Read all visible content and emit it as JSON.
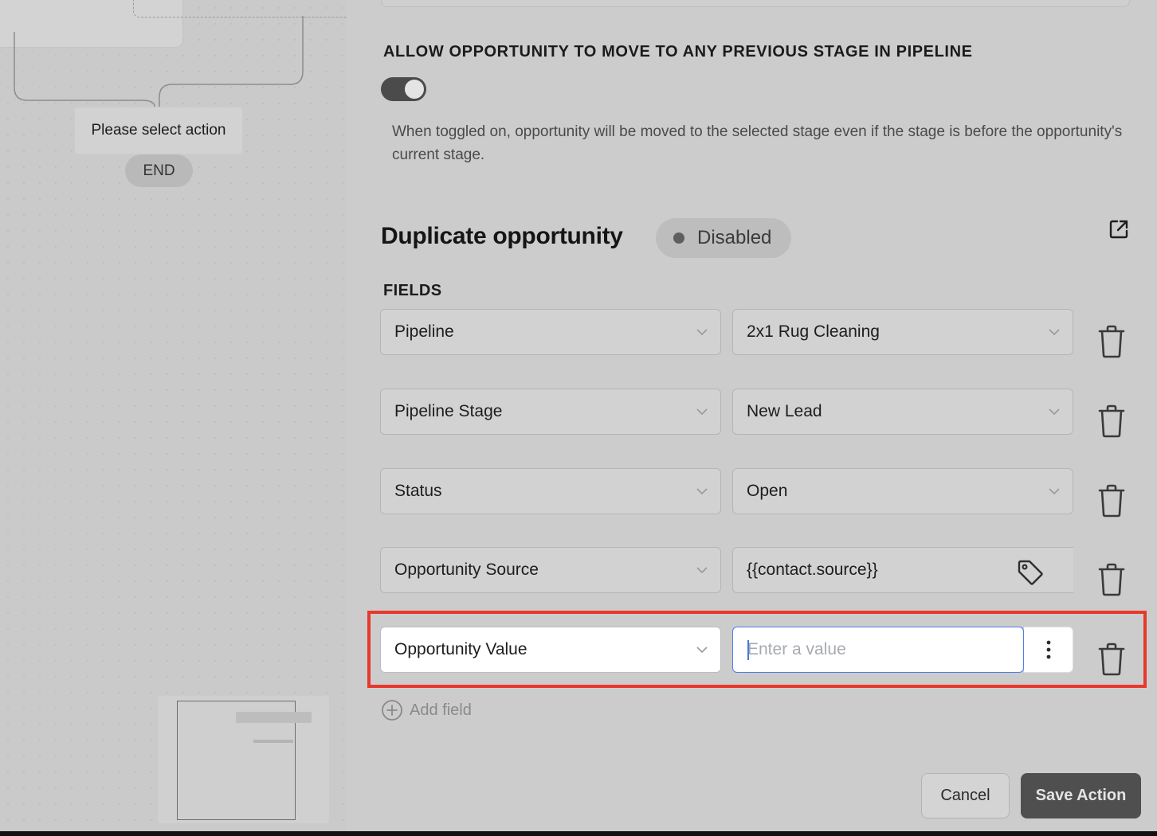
{
  "canvas": {
    "select_action_label": "Please select action",
    "end_label": "END"
  },
  "settings": {
    "allow_previous_stage_label": "ALLOW OPPORTUNITY TO MOVE TO ANY PREVIOUS STAGE IN PIPELINE",
    "toggle_on": true,
    "toggle_description": "When toggled on, opportunity will be moved to the selected stage even if the stage is before the opportunity's current stage."
  },
  "duplicate": {
    "title": "Duplicate opportunity",
    "status": "Disabled",
    "open_icon": "external-link-icon"
  },
  "fields": {
    "label": "FIELDS",
    "rows": [
      {
        "field": "Pipeline",
        "value": "2x1 Rug Cleaning"
      },
      {
        "field": "Pipeline Stage",
        "value": "New Lead"
      },
      {
        "field": "Status",
        "value": "Open"
      },
      {
        "field": "Opportunity Source",
        "value": "{{contact.source}}"
      },
      {
        "field": "Opportunity Value",
        "value": "",
        "placeholder": "Enter a value"
      }
    ],
    "add_label": "Add field"
  },
  "footer": {
    "cancel_label": "Cancel",
    "save_label": "Save Action"
  },
  "colors": {
    "highlight": "#e8382c",
    "input_focus": "#4d7ee8",
    "save_button": "#4f4f4f"
  }
}
